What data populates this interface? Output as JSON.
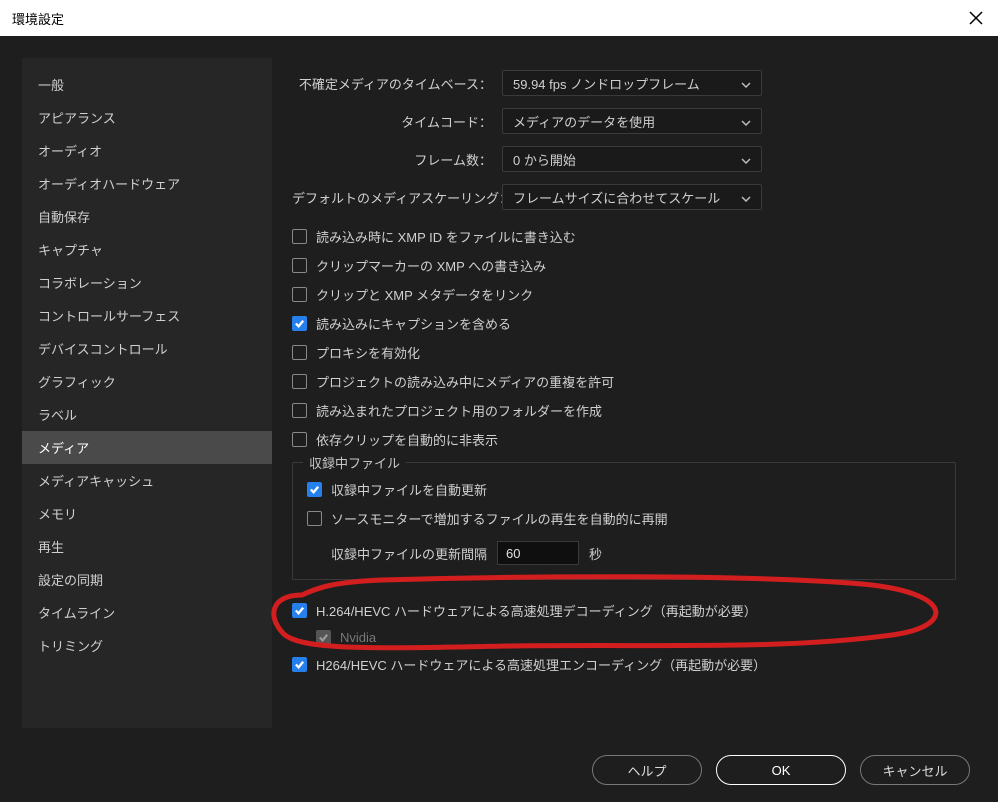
{
  "window": {
    "title": "環境設定"
  },
  "sidebar": {
    "items": [
      {
        "label": "一般"
      },
      {
        "label": "アピアランス"
      },
      {
        "label": "オーディオ"
      },
      {
        "label": "オーディオハードウェア"
      },
      {
        "label": "自動保存"
      },
      {
        "label": "キャプチャ"
      },
      {
        "label": "コラボレーション"
      },
      {
        "label": "コントロールサーフェス"
      },
      {
        "label": "デバイスコントロール"
      },
      {
        "label": "グラフィック"
      },
      {
        "label": "ラベル"
      },
      {
        "label": "メディア"
      },
      {
        "label": "メディアキャッシュ"
      },
      {
        "label": "メモリ"
      },
      {
        "label": "再生"
      },
      {
        "label": "設定の同期"
      },
      {
        "label": "タイムライン"
      },
      {
        "label": "トリミング"
      }
    ],
    "selected_index": 11
  },
  "main": {
    "rows": {
      "timebase_label": "不確定メディアのタイムベース：",
      "timebase_value": "59.94 fps ノンドロップフレーム",
      "timecode_label": "タイムコード：",
      "timecode_value": "メディアのデータを使用",
      "framecount_label": "フレーム数：",
      "framecount_value": "0 から開始",
      "scaling_label": "デフォルトのメディアスケーリング：",
      "scaling_value": "フレームサイズに合わせてスケール"
    },
    "checks": {
      "xmp_write": "読み込み時に XMP ID をファイルに書き込む",
      "clip_marker_xmp": "クリップマーカーの XMP への書き込み",
      "link_xmp": "クリップと XMP メタデータをリンク",
      "include_captions": "読み込みにキャプションを含める",
      "enable_proxy": "プロキシを有効化",
      "allow_dup": "プロジェクトの読み込み中にメディアの重複を許可",
      "create_folder": "読み込まれたプロジェクト用のフォルダーを作成",
      "auto_hide_dep": "依存クリップを自動的に非表示"
    },
    "ingest_group": {
      "legend": "収録中ファイル",
      "auto_refresh": "収録中ファイルを自動更新",
      "auto_resume": "ソースモニターで増加するファイルの再生を自動的に再開",
      "refresh_interval_label": "収録中ファイルの更新間隔",
      "refresh_interval_value": "60",
      "refresh_interval_unit": "秒"
    },
    "hw_decode": "H.264/HEVC ハードウェアによる高速処理デコーディング（再起動が必要）",
    "hw_decode_nvidia": "Nvidia",
    "hw_encode": "H264/HEVC ハードウェアによる高速処理エンコーディング（再起動が必要）"
  },
  "footer": {
    "help": "ヘルプ",
    "ok": "OK",
    "cancel": "キャンセル"
  }
}
